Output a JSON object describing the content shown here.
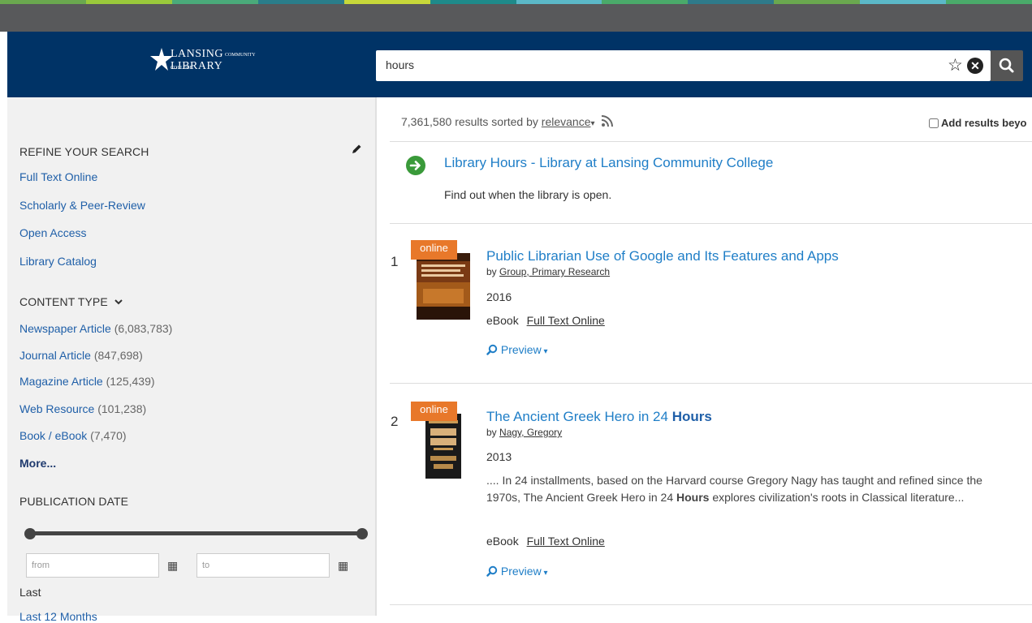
{
  "stripe_colors": [
    "#6aa84f",
    "#9ac93b",
    "#4aaa7a",
    "#2a7d8a",
    "#c7d83a",
    "#1e8a8a",
    "#5bb8c8",
    "#4aaa6a",
    "#2e7a8a",
    "#6aa84f",
    "#5bb8c8",
    "#4aaa6a"
  ],
  "header": {
    "logo": {
      "line1": "LANSING",
      "line1_small": "COMMUNITY COLLEGE",
      "line2": "LIBRARY"
    },
    "search": {
      "value": "hours"
    },
    "icons": {
      "favorite": "star-icon",
      "clear": "clear-icon",
      "submit": "search-icon"
    }
  },
  "sidebar": {
    "refine": {
      "heading": "REFINE YOUR SEARCH",
      "links": [
        "Full Text Online",
        "Scholarly & Peer-Review",
        "Open Access",
        "Library Catalog"
      ]
    },
    "content_type": {
      "heading": "CONTENT TYPE",
      "items": [
        {
          "label": "Newspaper Article",
          "count": "(6,083,783)"
        },
        {
          "label": "Journal Article",
          "count": "(847,698)"
        },
        {
          "label": "Magazine Article",
          "count": "(125,439)"
        },
        {
          "label": "Web Resource",
          "count": "(101,238)"
        },
        {
          "label": "Book / eBook",
          "count": "(7,470)"
        }
      ],
      "more": "More..."
    },
    "publication_date": {
      "heading": "PUBLICATION DATE",
      "from_placeholder": "from",
      "to_placeholder": "to",
      "last_label": "Last",
      "last_option": "Last 12 Months"
    }
  },
  "results": {
    "count": "7,361,580",
    "sorted_text": "results sorted by",
    "sort": "relevance",
    "add_results": "Add results beyo",
    "best_bet": {
      "title": "Library Hours - Library at Lansing Community College",
      "description": "Find out when the library is open."
    },
    "items": [
      {
        "number": "1",
        "badge": "online",
        "title": "Public Librarian Use of Google and Its Features and Apps",
        "by_prefix": "by",
        "author": "Group, Primary Research",
        "year": "2016",
        "format": "eBook",
        "availability": "Full Text Online",
        "preview": "Preview"
      },
      {
        "number": "2",
        "badge": "online",
        "title_parts": [
          "The Ancient Greek Hero in 24 ",
          "Hours"
        ],
        "by_prefix": "by",
        "author": "Nagy, Gregory",
        "year": "2013",
        "abstract_parts": [
          ".... In 24 installments, based on the Harvard course Gregory Nagy has taught and refined since the 1970s, The Ancient Greek Hero in 24 ",
          "Hours",
          " explores civilization's roots in Classical literature..."
        ],
        "format": "eBook",
        "availability": "Full Text Online",
        "preview": "Preview"
      }
    ]
  }
}
